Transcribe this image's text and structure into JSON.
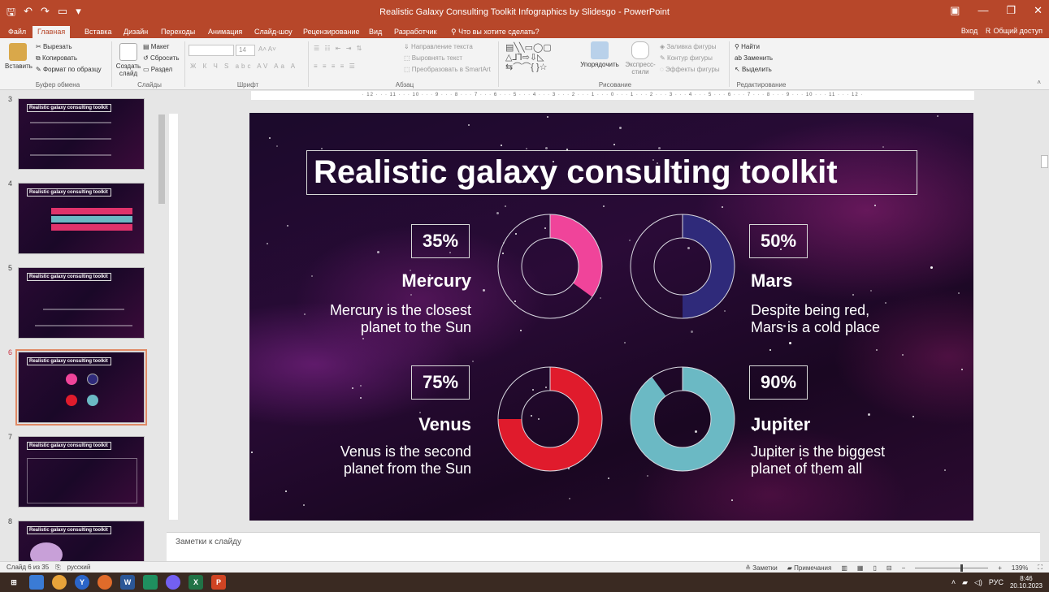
{
  "window": {
    "title": "Realistic Galaxy Consulting Toolkit Infographics by Slidesgo - PowerPoint",
    "login": "Вход",
    "share": "Общий доступ"
  },
  "menu": {
    "file": "Файл",
    "home": "Главная",
    "insert": "Вставка",
    "design": "Дизайн",
    "transitions": "Переходы",
    "animation": "Анимация",
    "slideshow": "Слайд-шоу",
    "review": "Рецензирование",
    "view": "Вид",
    "developer": "Разработчик",
    "tellme": "Что вы хотите сделать?"
  },
  "ribbon": {
    "paste": "Вставить",
    "cut": "Вырезать",
    "copy": "Копировать",
    "format_painter": "Формат по образцу",
    "clipboard": "Буфер обмена",
    "new_slide": "Создать слайд",
    "layout": "Макет",
    "reset": "Сбросить",
    "section": "Раздел",
    "slides": "Слайды",
    "font_size": "14",
    "font": "Шрифт",
    "text_direction": "Направление текста",
    "align_text": "Выровнять текст",
    "smartart": "Преобразовать в SmartArt",
    "paragraph": "Абзац",
    "arrange": "Упорядочить",
    "quick_styles": "Экспресс-стили",
    "shape_fill": "Заливка фигуры",
    "shape_outline": "Контур фигуры",
    "shape_effects": "Эффекты фигуры",
    "drawing": "Рисование",
    "find": "Найти",
    "replace": "Заменить",
    "select": "Выделить",
    "editing": "Редактирование"
  },
  "ruler_text": "· 12 · · · 11 · · · 10 · · · 9 · · · 8 · · · 7 · · · 6 · · · 5 · · · 4 · · · 3 · · · 2 · · · 1 · · · 0 · · · 1 · · · 2 · · · 3 · · · 4 · · · 5 · · · 6 · · · 7 · · · 8 · · · 9 · · · 10 · · · 11 · · · 12 ·",
  "thumbnails": [
    {
      "num": "3",
      "title": "Realistic galaxy consulting toolkit"
    },
    {
      "num": "4",
      "title": "Realistic galaxy consulting toolkit"
    },
    {
      "num": "5",
      "title": "Realistic galaxy consulting toolkit"
    },
    {
      "num": "6",
      "title": "Realistic galaxy consulting toolkit"
    },
    {
      "num": "7",
      "title": "Realistic galaxy consulting toolkit"
    },
    {
      "num": "8",
      "title": "Realistic galaxy consulting toolkit"
    }
  ],
  "slide": {
    "title": "Realistic galaxy consulting toolkit",
    "items": [
      {
        "pct": "35%",
        "name": "Mercury",
        "desc1": "Mercury is the closest",
        "desc2": "planet to the Sun",
        "value": 35,
        "color": "#f0449a"
      },
      {
        "pct": "50%",
        "name": "Mars",
        "desc1": "Despite being red,",
        "desc2": "Mars is a cold place",
        "value": 50,
        "color": "#2f2a7a"
      },
      {
        "pct": "75%",
        "name": "Venus",
        "desc1": "Venus is the second",
        "desc2": "planet from the Sun",
        "value": 75,
        "color": "#e01b2c"
      },
      {
        "pct": "90%",
        "name": "Jupiter",
        "desc1": "Jupiter is the biggest",
        "desc2": "planet of them all",
        "value": 90,
        "color": "#6bb9c4"
      }
    ]
  },
  "notes_placeholder": "Заметки к слайду",
  "status": {
    "slide": "Слайд 6 из 35",
    "lang": "русский",
    "notes": "Заметки",
    "comments": "Примечания",
    "zoom": "139%"
  },
  "tray": {
    "lang": "РУС",
    "time": "8:46",
    "date": "20.10.2023"
  }
}
